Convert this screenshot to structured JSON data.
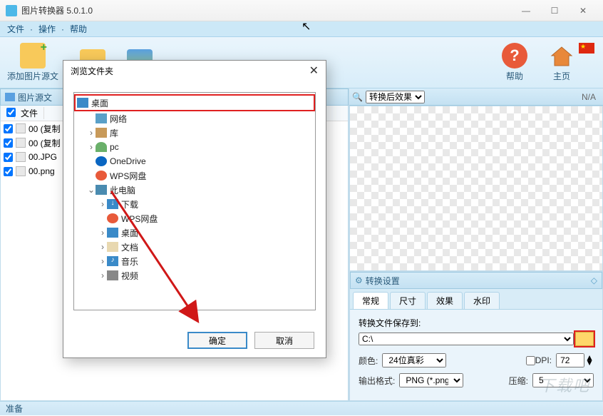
{
  "window": {
    "title": "图片转换器 5.0.1.0"
  },
  "menu": {
    "file": "文件",
    "op": "操作",
    "help": "帮助",
    "dot": "·"
  },
  "toolbar": {
    "add": "添加图片源文",
    "help": "帮助",
    "home": "主页"
  },
  "leftPanel": {
    "title": "图片源文",
    "col1": "文件",
    "files": [
      {
        "name": "00 (复制"
      },
      {
        "name": "00 (复制"
      },
      {
        "name": "00.JPG"
      },
      {
        "name": "00.png"
      }
    ]
  },
  "preview": {
    "search_icon": "🔍",
    "label": "转换后效果",
    "na": "N/A"
  },
  "settings": {
    "title": "转换设置",
    "tabs": {
      "general": "常规",
      "size": "尺寸",
      "effect": "效果",
      "watermark": "水印"
    },
    "saveTo": "转换文件保存到:",
    "path": "C:\\",
    "color": "颜色:",
    "colorVal": "24位真彩",
    "dpi": "DPI:",
    "dpiVal": "72",
    "outfmt": "输出格式:",
    "outfmtVal": "PNG (*.png)",
    "compress": "压缩:",
    "compressVal": "5"
  },
  "status": "准备",
  "dialog": {
    "title": "浏览文件夹",
    "tree": {
      "desktop": "桌面",
      "network": "网络",
      "library": "库",
      "pc_user": "pc",
      "onedrive": "OneDrive",
      "wps": "WPS网盘",
      "thispc": "此电脑",
      "download": "下载",
      "wps2": "WPS网盘",
      "desktop2": "桌面",
      "docs": "文档",
      "music": "音乐",
      "video": "视频"
    },
    "ok": "确定",
    "cancel": "取消"
  },
  "watermark": "下载吧"
}
